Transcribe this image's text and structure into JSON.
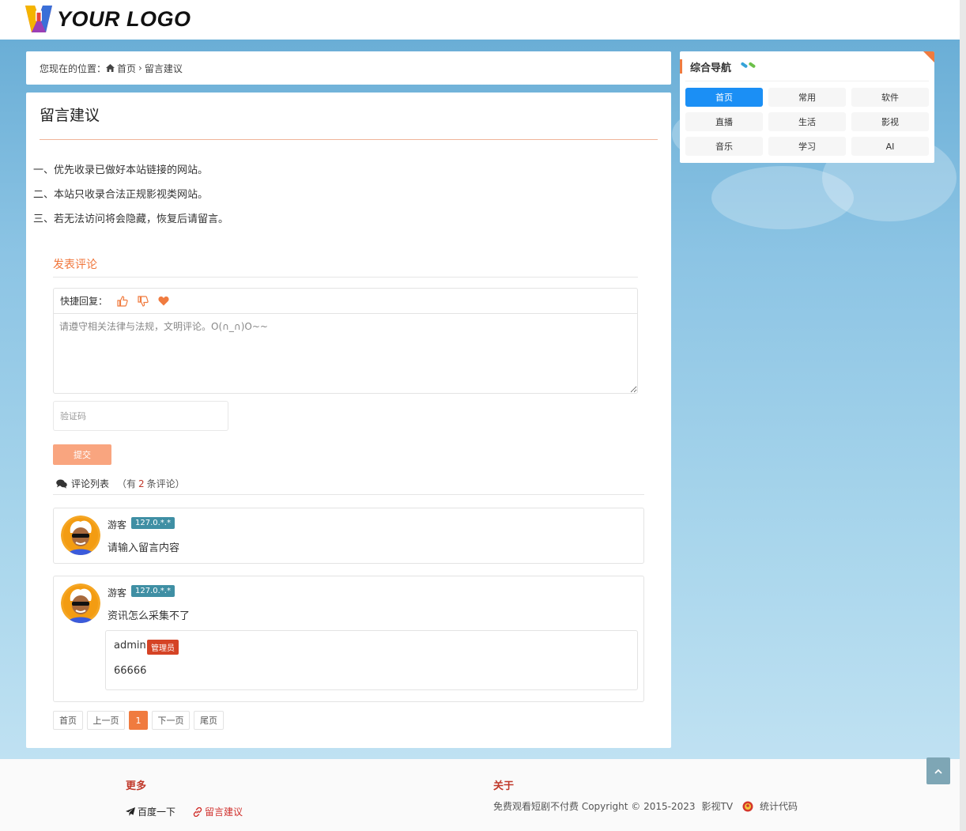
{
  "header": {
    "logo_text": "YOUR LOGO"
  },
  "breadcrumb": {
    "prefix": "您现在的位置：",
    "home": "首页",
    "current": "留言建议"
  },
  "main": {
    "title": "留言建议",
    "rules": [
      "一、优先收录已做好本站链接的网站。",
      "二、本站只收录合法正规影视类网站。",
      "三、若无法访问将会隐藏，恢复后请留言。"
    ]
  },
  "comment_form": {
    "section_title": "发表评论",
    "quick_reply_label": "快捷回复：",
    "textarea_placeholder": "请遵守相关法律与法规，文明评论。O(∩_∩)O~~",
    "captcha_placeholder": "验证码",
    "submit_label": "提交"
  },
  "comment_list": {
    "heading": "评论列表",
    "count_prefix": "（有",
    "count": "2",
    "count_suffix": "条评论）",
    "items": [
      {
        "user": "游客",
        "ip": "127.0.*.*",
        "text": "请输入留言内容"
      },
      {
        "user": "游客",
        "ip": "127.0.*.*",
        "text": "资讯怎么采集不了",
        "reply": {
          "user": "admin",
          "badge": "管理员",
          "text": "66666"
        }
      }
    ]
  },
  "pagination": {
    "first": "首页",
    "prev": "上一页",
    "current": "1",
    "next": "下一页",
    "last": "尾页"
  },
  "sidebar": {
    "title": "综合导航",
    "items": [
      {
        "label": "首页",
        "active": true
      },
      {
        "label": "常用"
      },
      {
        "label": "软件"
      },
      {
        "label": "直播"
      },
      {
        "label": "生活"
      },
      {
        "label": "影视"
      },
      {
        "label": "音乐"
      },
      {
        "label": "学习"
      },
      {
        "label": "AI"
      }
    ]
  },
  "footer": {
    "more_heading": "更多",
    "links": [
      {
        "label": "百度一下"
      },
      {
        "label": "留言建议"
      }
    ],
    "about_heading": "关于",
    "copyright": "免费观看短剧不付费 Copyright © 2015-2023",
    "site_name": "影视TV",
    "stats_label": "统计代码"
  },
  "colors": {
    "accent": "#f07b3f",
    "nav_active": "#1b8ff5",
    "ip_badge": "#3f8fa4",
    "admin_badge": "#d54325",
    "footer_heading": "#c0392b"
  },
  "icons": {
    "home": "home-icon",
    "thumb_up": "thumb-up-icon",
    "thumb_down": "thumb-down-icon",
    "heart": "heart-icon",
    "comments": "comments-icon",
    "send": "paper-plane-icon",
    "link": "link-icon",
    "emblem": "emblem-icon",
    "back_top": "chevron-up-icon"
  }
}
